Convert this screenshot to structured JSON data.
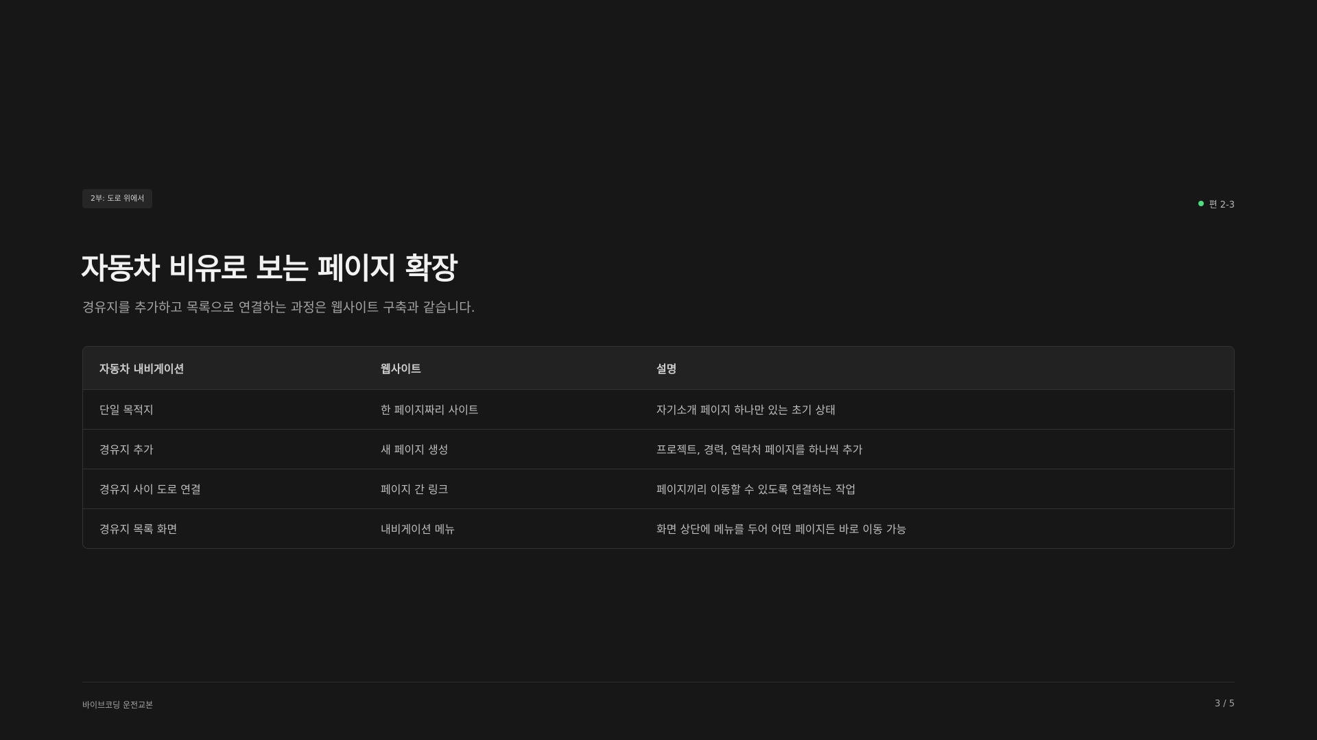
{
  "header": {
    "part_chip": "2부: 도로 위에서",
    "episode": "편 2-3",
    "status_color": "#4ade80"
  },
  "title": "자동차 비유로 보는 페이지 확장",
  "subtitle": "경유지를 추가하고 목록으로 연결하는 과정은 웹사이트 구축과 같습니다.",
  "table": {
    "headers": [
      "자동차 내비게이션",
      "웹사이트",
      "설명"
    ],
    "rows": [
      [
        "단일 목적지",
        "한 페이지짜리 사이트",
        "자기소개 페이지 하나만 있는 초기 상태"
      ],
      [
        "경유지 추가",
        "새 페이지 생성",
        "프로젝트, 경력, 연락처 페이지를 하나씩 추가"
      ],
      [
        "경유지 사이 도로 연결",
        "페이지 간 링크",
        "페이지끼리 이동할 수 있도록 연결하는 작업"
      ],
      [
        "경유지 목록 화면",
        "내비게이션 메뉴",
        "화면 상단에 메뉴를 두어 어떤 페이지든 바로 이동 가능"
      ]
    ]
  },
  "footer": {
    "brand": "바이브코딩 운전교본",
    "page_indicator": "3 / 5"
  }
}
